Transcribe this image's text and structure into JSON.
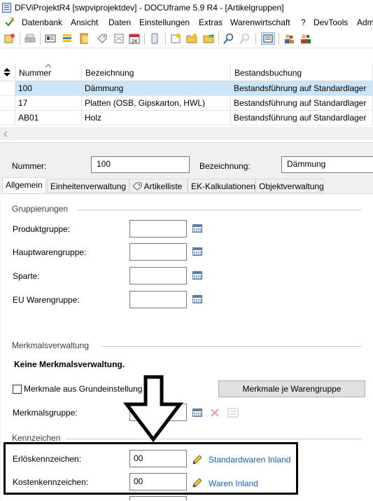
{
  "window": {
    "title": "DFViProjektR4 [swpviprojektdev] - DOCUframe 5.9 R4 - [Artikelgruppen]"
  },
  "menu": [
    "Datenbank",
    "Ansicht",
    "Daten",
    "Einstellungen",
    "Extras",
    "Warenwirtschaft",
    "?",
    "DevTools",
    "Adm"
  ],
  "toolbar_icons": [
    "new-record-icon",
    "print-icon",
    "card-icon",
    "list-icon",
    "folder-icon",
    "bookmark-icon",
    "tag-icon",
    "calendar-icon",
    "device-icon",
    "new-doc-icon",
    "open-folder-icon",
    "export-icon",
    "search-icon",
    "search-disabled-icon",
    "form-view-icon",
    "users-icon",
    "user-group-icon"
  ],
  "grid": {
    "columns": [
      "Nummer",
      "Bezeichnung",
      "Bestandsbuchung"
    ],
    "rows": [
      {
        "nummer": "100",
        "bezeichnung": "Dämmung",
        "bestand": "Bestandsführung auf Standardlager",
        "selected": true
      },
      {
        "nummer": "17",
        "bezeichnung": "Platten (OSB, Gipskarton, HWL)",
        "bestand": "Bestandsführung auf Standardlager",
        "selected": false
      },
      {
        "nummer": "AB01",
        "bezeichnung": "Holz",
        "bestand": "Bestandsführung auf Standardlager",
        "selected": false
      }
    ]
  },
  "header": {
    "nummer_label": "Nummer:",
    "nummer_value": "100",
    "bezeichnung_label": "Bezeichnung:",
    "bezeichnung_value": "Dämmung"
  },
  "tabs": [
    "Allgemein",
    "Einheitenverwaltung",
    "Artikelliste",
    "EK-Kalkulationen",
    "Objektverwaltung"
  ],
  "gruppierungen": {
    "title": "Gruppierungen",
    "fields": [
      {
        "label": "Produktgruppe:",
        "value": ""
      },
      {
        "label": "Hauptwarengruppe:",
        "value": ""
      },
      {
        "label": "Sparte:",
        "value": ""
      },
      {
        "label": "EU Warengruppe:",
        "value": ""
      }
    ]
  },
  "merkmale": {
    "title": "Merkmalsverwaltung",
    "info": "Keine Merkmalsverwaltung.",
    "checkbox_label": "Merkmale aus Grundeinstellung",
    "button_label": "Merkmale je Warengruppe",
    "gruppe_label": "Merkmalsgruppe:",
    "gruppe_value": ""
  },
  "kennzeichen": {
    "title": "Kennzeichen",
    "erloes_label": "Erlöskennzeichen:",
    "erloes_value": "00",
    "erloes_link": "Standardwaren Inland",
    "kosten_label": "Kostenkennzeichen:",
    "kosten_value": "00",
    "kosten_link": "Waren Inland"
  },
  "colors": {
    "selection": "#cce4f7",
    "link": "#1a5fb4",
    "annotation": "#000000"
  }
}
